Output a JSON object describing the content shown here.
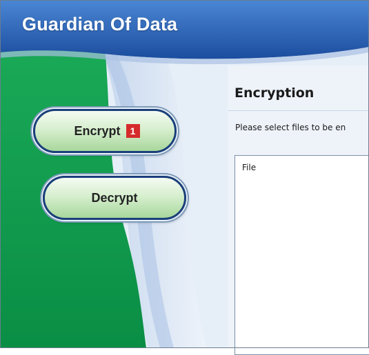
{
  "app": {
    "title": "Guardian Of Data"
  },
  "nav": {
    "encrypt_label": "Encrypt",
    "encrypt_badge": "1",
    "decrypt_label": "Decrypt"
  },
  "panel": {
    "title": "Encryption",
    "instruction": "Please select files to be en",
    "file_list": {
      "column_header": "File"
    }
  },
  "colors": {
    "header_blue": "#2c5eb0",
    "sidebar_green": "#0c9a4c",
    "panel_light_blue": "#e6eef8",
    "badge_red": "#d62b2b",
    "button_border": "#1a3f7a"
  },
  "icons": []
}
